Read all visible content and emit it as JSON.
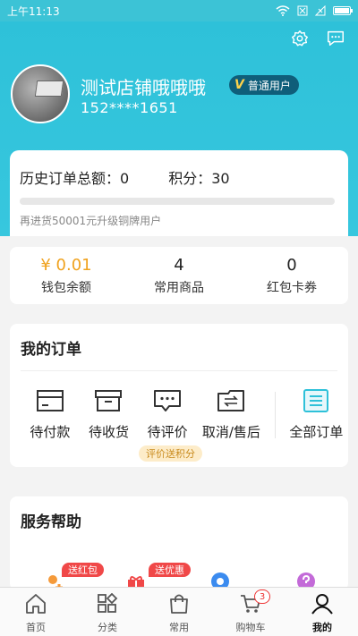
{
  "status": {
    "time": "上午11:13",
    "battery_level": 0.9
  },
  "user": {
    "name": "测试店铺哦哦哦",
    "phone": "152****1651",
    "badge": "普通用户",
    "badge_mark": "V"
  },
  "history": {
    "total_label": "历史订单总额：0",
    "points_label": "积分：30",
    "progress": 0,
    "note": "再进货50001元升级铜牌用户"
  },
  "stats": [
    {
      "value": "¥ 0.01",
      "label": "钱包余额"
    },
    {
      "value": "4",
      "label": "常用商品"
    },
    {
      "value": "0",
      "label": "红包卡券"
    }
  ],
  "orders": {
    "title": "我的订单",
    "items": [
      {
        "label": "待付款",
        "icon": "wallet-icon"
      },
      {
        "label": "待收货",
        "icon": "box-icon"
      },
      {
        "label": "待评价",
        "icon": "comment-icon"
      },
      {
        "label": "取消/售后",
        "icon": "return-icon"
      }
    ],
    "all_label": "全部订单",
    "hint": "评价送积分"
  },
  "service": {
    "title": "服务帮助",
    "tags": [
      "送红包",
      "送优惠"
    ]
  },
  "tabbar": {
    "items": [
      {
        "label": "首页",
        "icon": "home-icon"
      },
      {
        "label": "分类",
        "icon": "category-icon"
      },
      {
        "label": "常用",
        "icon": "bag-icon"
      },
      {
        "label": "购物车",
        "icon": "cart-icon"
      },
      {
        "label": "我的",
        "icon": "profile-icon"
      }
    ],
    "cart_count": "3",
    "active_index": 4
  },
  "colors": {
    "accent": "#2ec1d9",
    "money": "#f0a21e",
    "tag_red": "#f04848"
  }
}
